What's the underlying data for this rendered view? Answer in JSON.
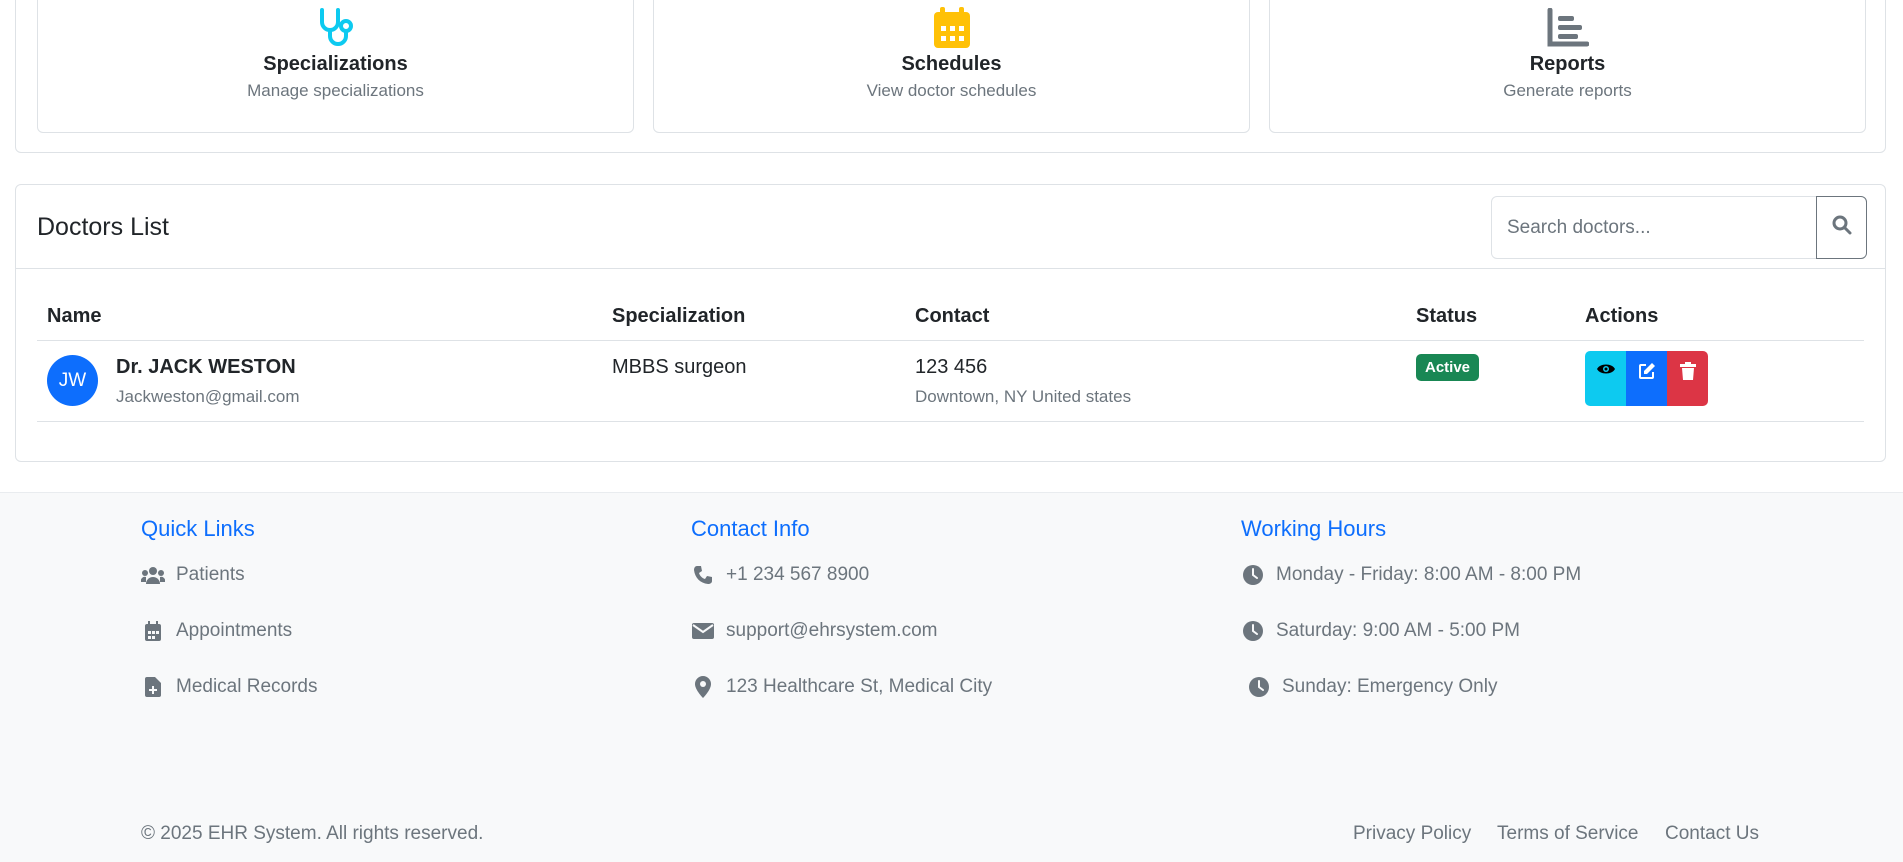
{
  "features": [
    {
      "title": "Specializations",
      "description": "Manage specializations",
      "icon": "stethoscope-icon",
      "color": "#0dcaf0"
    },
    {
      "title": "Schedules",
      "description": "View doctor schedules",
      "icon": "calendar-icon",
      "color": "#ffc107"
    },
    {
      "title": "Reports",
      "description": "Generate reports",
      "icon": "chart-bar-icon",
      "color": "#6c757d"
    }
  ],
  "doctors_list": {
    "title": "Doctors List",
    "search_placeholder": "Search doctors...",
    "columns": [
      "Name",
      "Specialization",
      "Contact",
      "Status",
      "Actions"
    ],
    "rows": [
      {
        "initials": "JW",
        "name": "Dr. JACK WESTON",
        "email": "Jackweston@gmail.com",
        "specialization": "MBBS surgeon",
        "phone": "123 456",
        "address": "Downtown, NY United states",
        "status": "Active",
        "status_color": "#198754"
      }
    ],
    "action_colors": {
      "view": "#0dcaf0",
      "edit": "#0d6efd",
      "delete": "#dc3545"
    }
  },
  "footer": {
    "quick_links": {
      "title": "Quick Links",
      "items": [
        {
          "label": "Patients",
          "icon": "users-icon"
        },
        {
          "label": "Appointments",
          "icon": "calendar-icon"
        },
        {
          "label": "Medical Records",
          "icon": "file-medical-icon"
        }
      ]
    },
    "contact_info": {
      "title": "Contact Info",
      "items": [
        {
          "label": "+1 234 567 8900",
          "icon": "phone-icon"
        },
        {
          "label": "support@ehrsystem.com",
          "icon": "envelope-icon"
        },
        {
          "label": "123 Healthcare St, Medical City",
          "icon": "map-marker-icon"
        }
      ]
    },
    "working_hours": {
      "title": "Working Hours",
      "items": [
        {
          "label": "Monday - Friday: 8:00 AM - 8:00 PM",
          "icon": "clock-icon"
        },
        {
          "label": "Saturday: 9:00 AM - 5:00 PM",
          "icon": "clock-icon"
        },
        {
          "label": "Sunday: Emergency Only",
          "icon": "clock-icon"
        }
      ]
    },
    "copyright": "© 2025 EHR System. All rights reserved.",
    "links": [
      "Privacy Policy",
      "Terms of Service",
      "Contact Us"
    ],
    "accent_color": "#0d6efd"
  }
}
